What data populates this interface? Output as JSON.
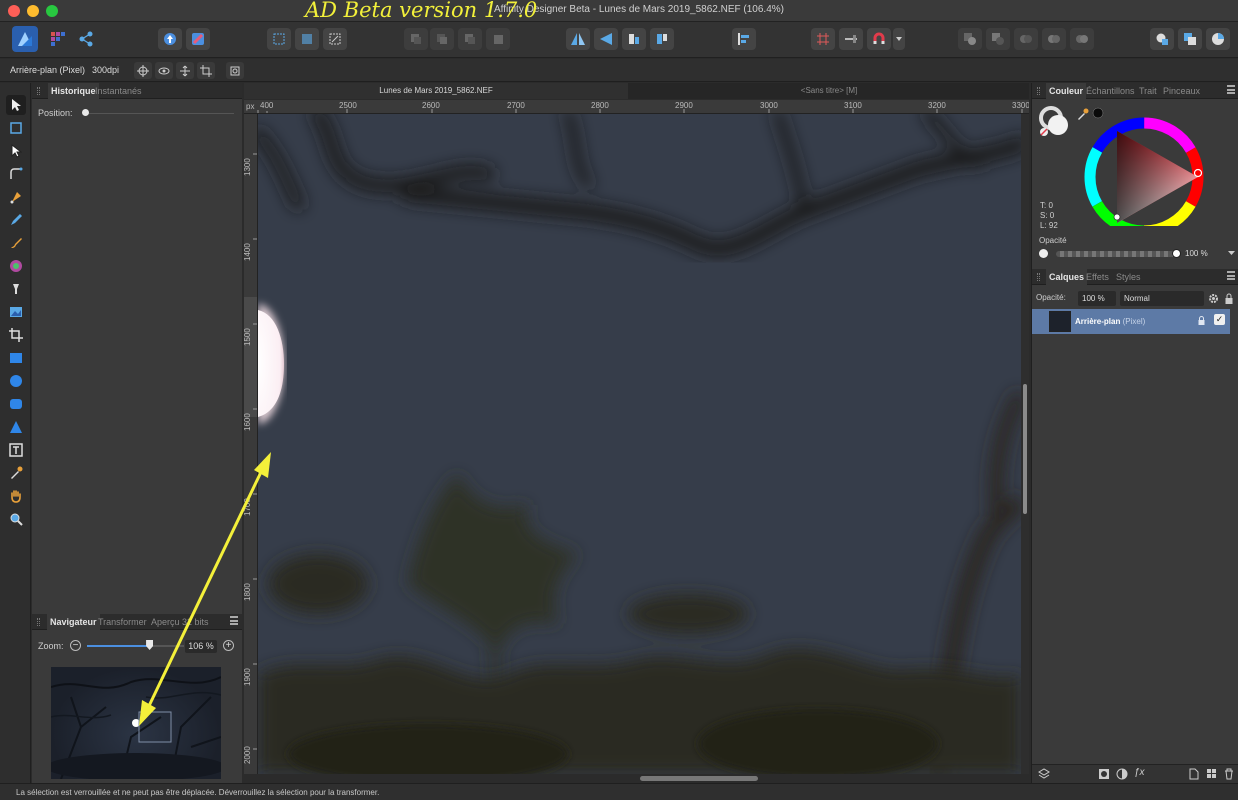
{
  "window": {
    "title": "Affinity Designer Beta - Lunes de Mars 2019_5862.NEF (106.4%)",
    "beta_label": "AD Beta version 1.7.0"
  },
  "context_bar": {
    "layer_label": "Arrière-plan (Pixel)",
    "dpi": "300dpi"
  },
  "history_panel": {
    "tabs": [
      "Historique",
      "Instantanés"
    ],
    "position_label": "Position:"
  },
  "navigator_panel": {
    "tabs": [
      "Navigateur",
      "Transformer",
      "Aperçu 32 bits"
    ],
    "zoom_label": "Zoom:",
    "zoom_value": "106 %",
    "zoom_fraction": 0.64
  },
  "documents": {
    "tabs": [
      "Lunes de Mars 2019_5862.NEF",
      "<Sans titre> [M]"
    ]
  },
  "rulers": {
    "unit": "px",
    "horizontal": [
      "400",
      "2500",
      "2600",
      "2700",
      "2800",
      "2900",
      "3000",
      "3100",
      "3200",
      "3300"
    ],
    "vertical": [
      "1300",
      "1400",
      "1500",
      "1600",
      "1700",
      "1800",
      "1900",
      "2000"
    ]
  },
  "color_panel": {
    "tabs": [
      "Couleur",
      "Échantillons",
      "Trait",
      "Pinceaux"
    ],
    "readout": {
      "t": "T: 0",
      "s": "S: 0",
      "l": "L: 92"
    },
    "opacity_label": "Opacité",
    "opacity_value": "100 %",
    "hue_color": "#d6252f"
  },
  "layers_panel": {
    "tabs": [
      "Calques",
      "Effets",
      "Styles"
    ],
    "opacity_label": "Opacité:",
    "opacity_value": "100 %",
    "blend_mode": "Normal",
    "layers": [
      {
        "name": "Arrière-plan",
        "type": "(Pixel)",
        "visible": true
      }
    ]
  },
  "status": {
    "text": "La sélection est verrouillée et ne peut pas être déplacée. Déverrouillez la sélection pour la transformer."
  },
  "colors": {
    "accent": "#4b8fe0",
    "annotation": "#f4f03a",
    "canvas_sky": "#353c48"
  }
}
